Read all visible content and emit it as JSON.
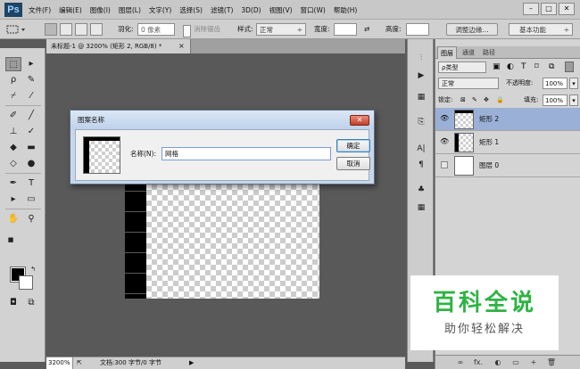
{
  "app": {
    "logo": "Ps"
  },
  "menu": [
    "文件(F)",
    "编辑(E)",
    "图像(I)",
    "图层(L)",
    "文字(Y)",
    "选择(S)",
    "滤镜(T)",
    "3D(D)",
    "视图(V)",
    "窗口(W)",
    "帮助(H)"
  ],
  "window_controls": {
    "minimize": "–",
    "maximize": "□",
    "close": "✕"
  },
  "options_bar": {
    "feather_label": "羽化:",
    "feather_value": "0 像素",
    "antialias_label": "消除锯齿",
    "style_label": "样式:",
    "style_value": "正常",
    "width_label": "宽度:",
    "swap_icon": "⇄",
    "height_label": "高度:",
    "refine_edge": "调整边缘...",
    "workspace": "基本功能"
  },
  "document": {
    "tab_title": "未标题-1 @ 3200% (矩形 2, RGB/8) *",
    "tab_close": "×"
  },
  "status_bar": {
    "zoom": "3200%",
    "doc_info": "文档:300 字节/0 字节",
    "arrow": "▶"
  },
  "dialog": {
    "title": "图案名称",
    "close": "✕",
    "name_label": "名称(N):",
    "name_value": "网格",
    "ok": "确定",
    "cancel": "取消"
  },
  "layers_panel": {
    "tabs": [
      "图层",
      "通道",
      "路径"
    ],
    "kind_filter": "ρ类型",
    "blend_mode": "正常",
    "opacity_label": "不透明度:",
    "opacity_value": "100%",
    "lock_label": "锁定:",
    "fill_label": "填充:",
    "fill_value": "100%",
    "layers": [
      {
        "name": "矩形 2",
        "visible": true,
        "selected": true
      },
      {
        "name": "矩形 1",
        "visible": true,
        "selected": false
      },
      {
        "name": "图层 0",
        "visible": false,
        "selected": false
      }
    ],
    "bottom_icons": [
      "∞",
      "fx.",
      "◐",
      "▭",
      "+",
      "🗑"
    ]
  },
  "watermark": {
    "title": "百科全说",
    "subtitle": "助你轻松解决"
  },
  "colors": {
    "workspace": "#595959",
    "selected_layer": "#9bb0d6",
    "watermark_green": "#2fb344"
  }
}
